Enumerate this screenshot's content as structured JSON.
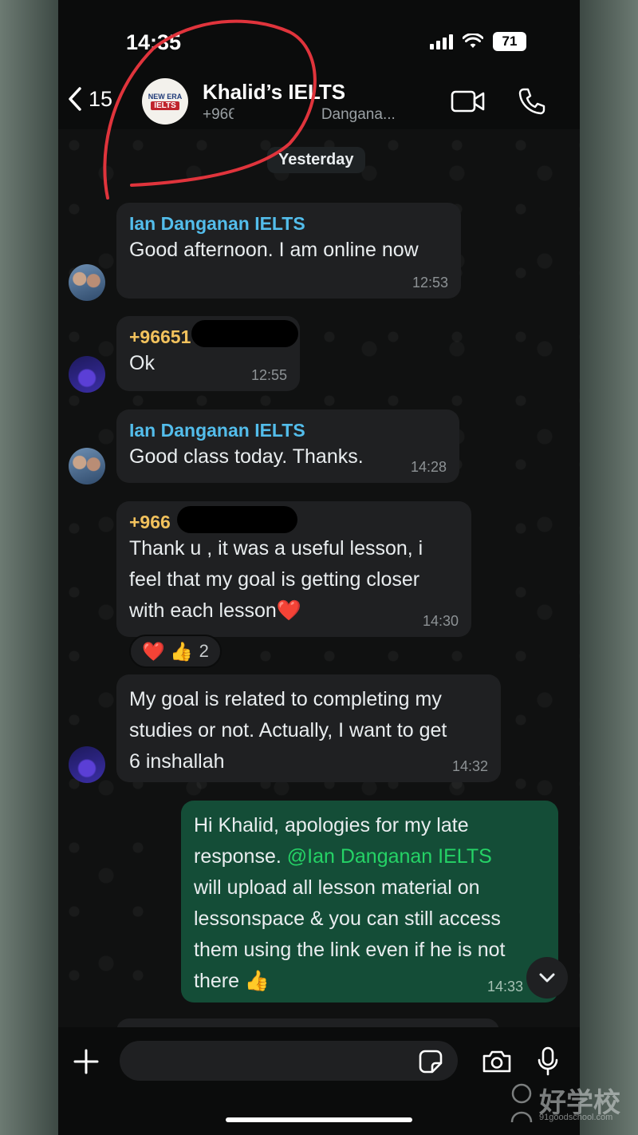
{
  "status_bar": {
    "time": "14:35",
    "battery": "71"
  },
  "header": {
    "back_count": "15",
    "group_name": "Khalid’s IELTS",
    "subtitle": "+966 ••• •••••, Ian Dangana...",
    "avatar_logo": {
      "top": "NEW ERA",
      "bottom": "IELTS"
    }
  },
  "date_separator": "Yesterday",
  "messages": [
    {
      "sender": "Ian Danganan IELTS",
      "text": "Good afternoon. I am online now",
      "time": "12:53"
    },
    {
      "sender": "+96651",
      "text": "Ok",
      "time": "12:55"
    },
    {
      "sender": "Ian Danganan IELTS",
      "text": "Good class today. Thanks.",
      "time": "14:28"
    },
    {
      "sender": "+966",
      "lines": [
        "Thank u , it was a useful lesson, i",
        "feel that my goal is getting closer",
        "with each lesson❤️"
      ],
      "time": "14:30",
      "reactions": {
        "emojis": "❤️ 👍",
        "count": "2"
      }
    },
    {
      "lines": [
        "My goal is related to completing my",
        "studies or not. Actually, I want to get",
        "6 inshallah"
      ],
      "time": "14:32"
    },
    {
      "line1": "Hi Khalid, apologies for my late",
      "line2_prefix": "response. ",
      "mention": "@Ian Danganan IELTS",
      "lines_rest": [
        "will upload all lesson material on",
        "lessonspace & you can still access",
        "them using the link even if he is not",
        "there 👍"
      ],
      "time": "14:33"
    }
  ],
  "composer": {
    "placeholder": ""
  },
  "colors": {
    "incoming": "#1f2022",
    "outgoing": "#144d37",
    "sender_teal": "#53bdeb",
    "sender_gold": "#f2c25d",
    "mention": "#25d366",
    "annotation": "#e0343c"
  },
  "watermark": {
    "text": "好学校",
    "sub": "91goodschool.com"
  }
}
